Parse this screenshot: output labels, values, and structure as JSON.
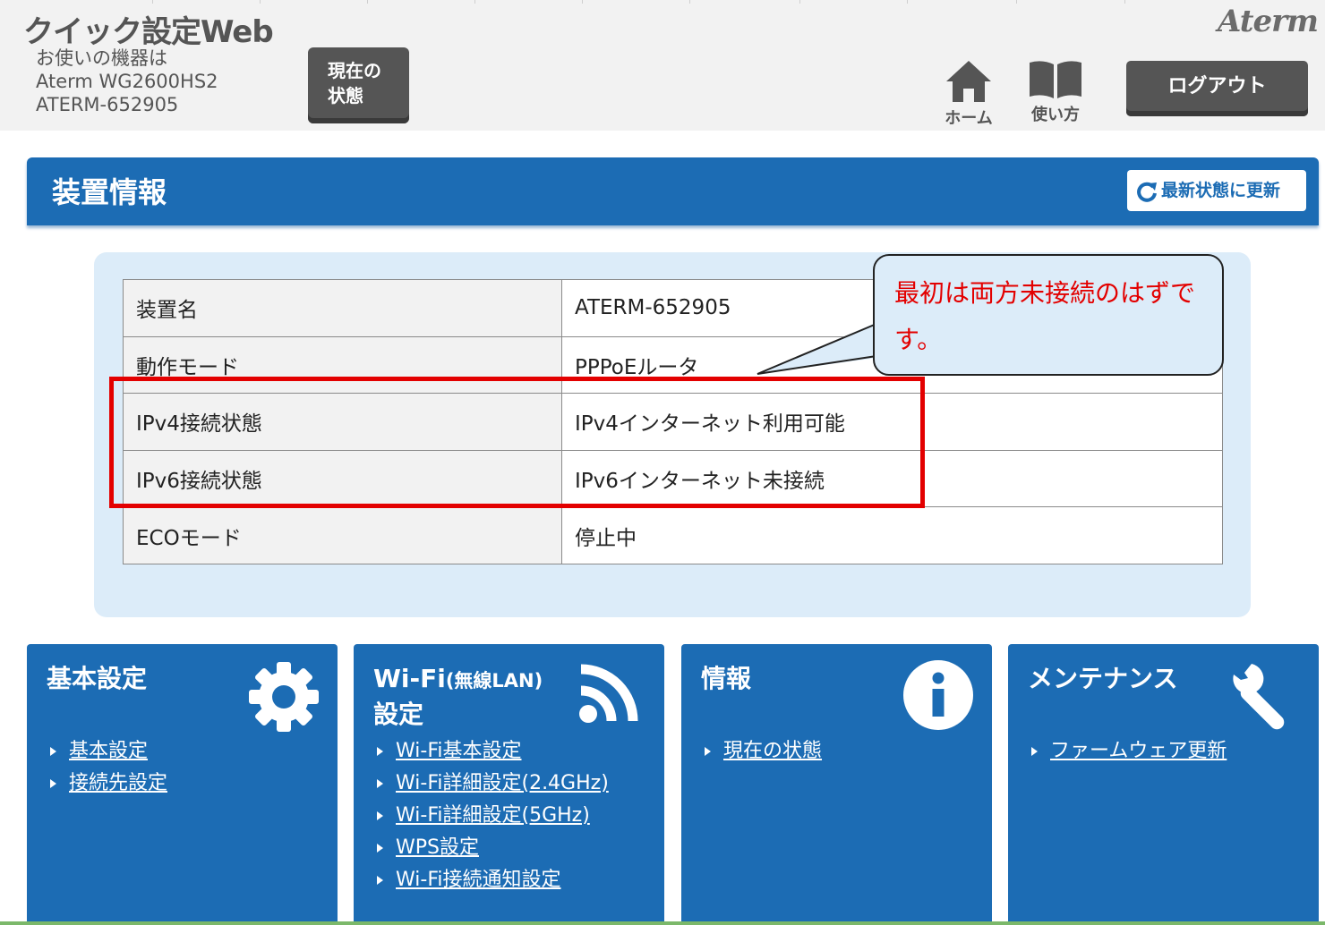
{
  "header": {
    "app_title": "クイック設定Web",
    "device_lines": [
      "お使いの機器は",
      "Aterm WG2600HS2",
      "ATERM-652905"
    ],
    "status_button": [
      "現在の",
      "状態"
    ],
    "brand": "Aterm",
    "nav": {
      "home_label": "ホーム",
      "help_label": "使い方"
    },
    "logout_label": "ログアウト"
  },
  "section": {
    "title": "装置情報",
    "refresh_label": "最新状態に更新"
  },
  "info_table": {
    "rows": [
      {
        "key": "装置名",
        "value": "ATERM-652905"
      },
      {
        "key": "動作モード",
        "value": "PPPoEルータ"
      },
      {
        "key": "IPv4接続状態",
        "value": "IPv4インターネット利用可能"
      },
      {
        "key": "IPv6接続状態",
        "value": "IPv6インターネット未接続"
      },
      {
        "key": "ECOモード",
        "value": "停止中"
      }
    ]
  },
  "callout": {
    "text": "最初は両方未接続のはずです。"
  },
  "cards": [
    {
      "title": "基本設定",
      "icon": "gear-icon",
      "links": [
        "基本設定",
        "接続先設定"
      ]
    },
    {
      "title_main": "Wi-Fi",
      "title_small": "(無線LAN)",
      "title_line2": "設定",
      "icon": "wifi-icon",
      "links": [
        "Wi-Fi基本設定",
        "Wi-Fi詳細設定(2.4GHz)",
        "Wi-Fi詳細設定(5GHz)",
        "WPS設定",
        "Wi-Fi接続通知設定"
      ]
    },
    {
      "title": "情報",
      "icon": "info-icon",
      "links": [
        "現在の状態"
      ]
    },
    {
      "title": "メンテナンス",
      "icon": "wrench-icon",
      "links": [
        "ファームウェア更新"
      ]
    }
  ],
  "colors": {
    "primary": "#1c6cb4",
    "panel": "#dcecf9",
    "header_bg": "#f2f2f2",
    "dark_button": "#555555",
    "highlight": "#e30000"
  }
}
